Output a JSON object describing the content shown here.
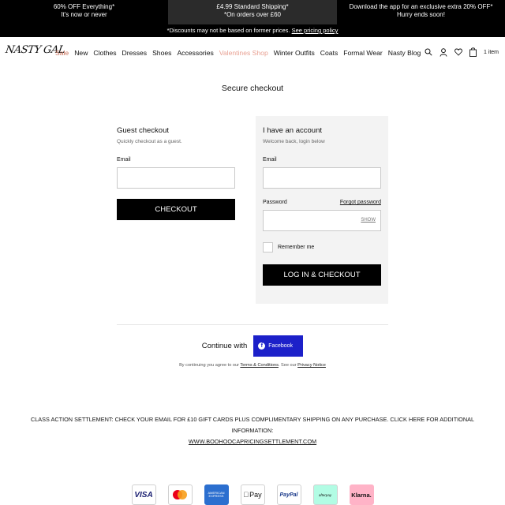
{
  "promo_bar": {
    "left_line1": "60% OFF Everything*",
    "left_line2": "It's now or never",
    "mid_line1": "£4.99 Standard Shipping*",
    "mid_line2": "*On orders over £60",
    "right_line1": "Download the app for an exclusive extra 20% OFF*",
    "right_line2": "Hurry ends soon!"
  },
  "notice": {
    "text": "*Discounts may not be based on former prices.",
    "link": "See pricing policy"
  },
  "header": {
    "logo": "NASTY GAL",
    "nav": [
      "Sale",
      "New",
      "Clothes",
      "Dresses",
      "Shoes",
      "Accessories",
      "Valentines Shop",
      "Winter Outfits",
      "Coats",
      "Formal Wear",
      "Nasty Blog"
    ],
    "bag_count": "1 item"
  },
  "page_title": "Secure checkout",
  "guest": {
    "title": "Guest checkout",
    "subtitle": "Quickly checkout as a guest.",
    "email_label": "Email",
    "email_value": "",
    "button": "CHECKOUT"
  },
  "account": {
    "title": "I have an account",
    "subtitle": "Welcome back, login below",
    "email_label": "Email",
    "email_value": "",
    "password_label": "Password",
    "forgot": "Forgot password",
    "show": "SHOW",
    "remember": "Remember me",
    "button": "LOG IN & CHECKOUT"
  },
  "social": {
    "continue_text": "Continue with",
    "facebook_label": "Facebook"
  },
  "terms": {
    "prefix": "By continuing you agree to our",
    "terms_link": "Terms & Conditions",
    "middle": ". See our",
    "privacy_link": "Privacy Notice"
  },
  "class_action": {
    "text": "CLASS ACTION SETTLEMENT: CHECK YOUR EMAIL FOR £10 GIFT CARDS PLUS COMPLIMENTARY SHIPPING ON ANY PURCHASE. CLICK HERE FOR ADDITIONAL INFORMATION:",
    "url": "WWW.BOOHOOCAPRICINGSETTLEMENT.COM"
  },
  "payments": {
    "visa": "VISA",
    "amex": "AMERICAN EXPRESS",
    "apple": "Pay",
    "paypal": "PayPal",
    "afterpay": "afterpay",
    "klarna": "Klarna."
  },
  "colors": {
    "sale": "#c8705a",
    "valentines": "#e8a092",
    "facebook": "#1c20c9",
    "panel": "#f3f3f3"
  }
}
